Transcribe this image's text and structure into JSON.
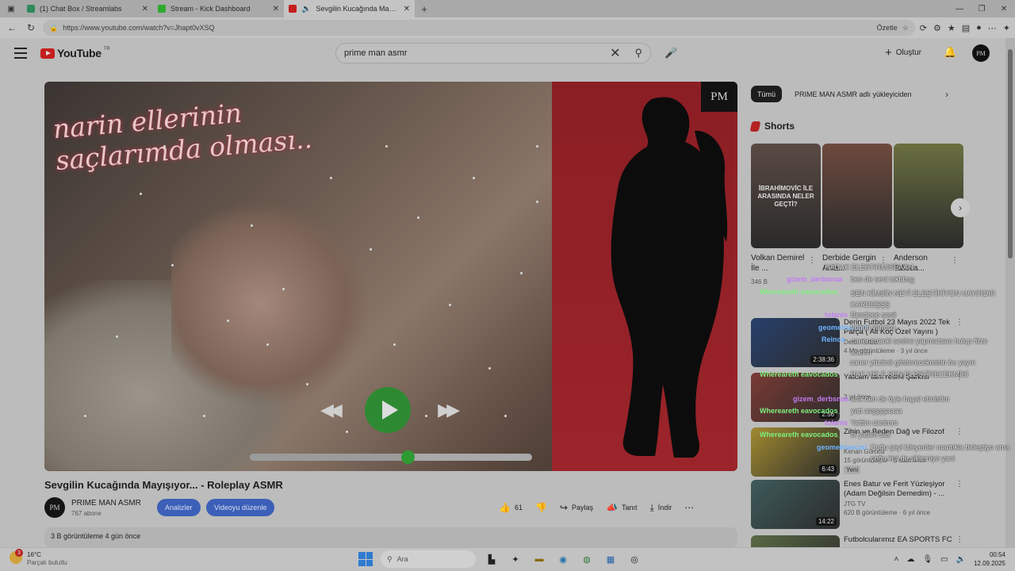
{
  "browser": {
    "tabs": [
      {
        "title": "(1) Chat Box / Streamlabs",
        "color": "#2e8a5a",
        "active": false
      },
      {
        "title": "Stream - Kick Dashboard",
        "color": "#2eaa2e",
        "active": false
      },
      {
        "title": "Sevgilin Kucağında Mayışyor...",
        "color": "#c41e1e",
        "active": true
      }
    ],
    "url": "https://www.youtube.com/watch?v=Jhapt0vXSQ",
    "summarize_label": "Özetle"
  },
  "youtube": {
    "logo_text": "YouTube",
    "country_code": "TR",
    "search_value": "prime man asmr",
    "create_label": "Oluştur",
    "avatar_initials": "PM"
  },
  "video": {
    "overlay_line1": "narin ellerinin",
    "overlay_line2": "saçlarımda olması..",
    "badge": "PM",
    "progress": 0.56,
    "title": "Sevgilin Kucağında Mayışıyor... - Roleplay ASMR",
    "channel_name": "PRIME MAN ASMR",
    "channel_subs": "767 abone",
    "analytics_label": "Analizler",
    "edit_label": "Videoyu düzenle",
    "likes": "61",
    "share_label": "Paylaş",
    "promote_label": "Tanıt",
    "download_label": "İndir",
    "views_date": "3 B görüntüleme  4 gün önce"
  },
  "sidebar": {
    "chips": [
      "Tümü",
      "PRIME MAN ASMR adlı yükleyiciden"
    ],
    "shorts_title": "Shorts",
    "shorts": [
      {
        "title": "Volkan Demirel İle ...",
        "views": "346 B",
        "caption": "İBRAHİMOVİC İLE ARASINDA NELER GEÇTİ?",
        "color": "#5a4a44"
      },
      {
        "title": "Derbide Gergin Anla...",
        "views": "",
        "caption": "",
        "color": "#6e4a3e"
      },
      {
        "title": "Anderson Talisca...",
        "views": "",
        "caption": "",
        "color": "#6a7040"
      }
    ],
    "recommended": [
      {
        "title": "Derin Futbol 23 Mayıs 2022 Tek Parça ( Ali Koç Özel Yayını )",
        "channel": "Derin Futbol",
        "meta": "4 Mn görüntüleme · 3 yıl önce",
        "duration": "2:38:36",
        "color": "#27406b"
      },
      {
        "title": "Yatcam tam resmi Şarkısı",
        "channel": "",
        "meta": "3 yıl önce",
        "duration": "2:56",
        "color": "#7a3a34"
      },
      {
        "title": "Zihin ve Beden Dağ ve Filozof",
        "channel": "Kenan Görücü",
        "meta": "15 görüntüleme · 5 saat önce",
        "badge": "Yeni",
        "duration": "6:43",
        "color": "#a08a30"
      },
      {
        "title": "Enes Batur ve Ferit Yüzleşiyor (Adam Değilsin Demedim) - ...",
        "channel": "JTG TV",
        "meta": "620 B görüntüleme · 6 yıl önce",
        "duration": "14:22",
        "color": "#3e5a5a"
      },
      {
        "title": "Futbolcularımız EA SPORTS FC",
        "channel": "",
        "meta": "",
        "duration": "",
        "color": "#5a6a44"
      }
    ]
  },
  "chat": [
    {
      "user": "",
      "text": "HADAK ELESTIRMISEAAH",
      "color": "#ffffff"
    },
    {
      "user": "gizem_derbsnaa",
      "text": "ben de seni tskbbsg",
      "color": "#c27cf0"
    },
    {
      "user": "Whereareth eavocados_",
      "text": "SEN KİMSİN NEYİ ELEŞTİRİYON HAYIRDIR KARDEŞŞŞ",
      "color": "#7ef07e"
    },
    {
      "user": "tolanis",
      "text": "Bendeee senii",
      "color": "#c27cf0"
    },
    {
      "user": "geometriavcisi",
      "text": "yoğun yancsq",
      "color": "#6fb3ff"
    },
    {
      "user": "Reinca",
      "text": "caner suanki sesine yapmazsan bulup füze atarım",
      "color": "#6fb3ff"
    },
    {
      "user": "",
      "text": "caner yüzünü gösterecekmisin bu yayın",
      "color": "#ffffff"
    },
    {
      "user": "Whereareth eavocados_",
      "text": "BAK HELE SEN ELEŞTİRECEKMİSİ",
      "color": "#7ef07e"
    },
    {
      "user": "gizem_derbsnaa",
      "text": "ana ben de öyle hayal etmistim",
      "color": "#c27cf0"
    },
    {
      "user": "Whereareth eavocados_",
      "text": "yatt asşşşşaaaa",
      "color": "#7ef07e"
    },
    {
      "user": "tolanis",
      "text": "Yattim canimm",
      "color": "#c27cf0"
    },
    {
      "user": "Whereareth eavocados_",
      "text": "bi yatlim sus",
      "color": "#7ef07e"
    },
    {
      "user": "geometriavcisi",
      "text": "Çoğu şeyi izleyenler mantıkla birleştiyo ama",
      "color": "#6fb3ff"
    },
    {
      "user": "",
      "text": "çoğu kişi de siklemiyo yani",
      "color": "#ffffff"
    }
  ],
  "taskbar": {
    "temperature": "16°C",
    "weather_desc": "Parçalı bulutlu",
    "search_placeholder": "Ara",
    "time": "00:54",
    "date": "12.09.2025"
  }
}
